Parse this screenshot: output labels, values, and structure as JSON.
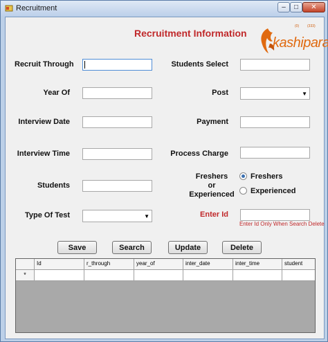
{
  "window": {
    "title": "Recruitment",
    "min_glyph": "–",
    "max_glyph": "□",
    "close_glyph": "✕"
  },
  "header": {
    "title": "Recruitment Information",
    "logo_text": "kashipara",
    "logo_small_left": "(0)",
    "logo_small_right": "(333)"
  },
  "form": {
    "recruit_through": {
      "label": "Recruit Through",
      "value": ""
    },
    "year_of": {
      "label": "Year Of",
      "value": ""
    },
    "interview_date": {
      "label": "Interview Date",
      "value": ""
    },
    "interview_time": {
      "label": "Interview Time",
      "value": ""
    },
    "students": {
      "label": "Students",
      "value": ""
    },
    "type_of_test": {
      "label": "Type Of Test",
      "value": ""
    },
    "students_select": {
      "label": "Students Select",
      "value": ""
    },
    "post": {
      "label": "Post",
      "value": ""
    },
    "payment": {
      "label": "Payment",
      "value": ""
    },
    "process_charge": {
      "label": "Process Charge",
      "value": ""
    },
    "freshers_or_experienced": {
      "label_line1": "Freshers",
      "label_line2": "or",
      "label_line3": "Experienced",
      "options": [
        "Freshers",
        "Experienced"
      ],
      "selected": "Freshers"
    },
    "enter_id": {
      "label": "Enter Id",
      "value": ""
    },
    "hint": "Enter Id Only When Search  Delete"
  },
  "buttons": {
    "save": "Save",
    "search": "Search",
    "update": "Update",
    "delete": "Delete"
  },
  "grid": {
    "columns": [
      "Id",
      "r_through",
      "year_of",
      "inter_date",
      "inter_time",
      "student"
    ],
    "new_row_marker": "*"
  },
  "colors": {
    "heading": "#c0282a",
    "logo": "#e06a10",
    "grid_background": "#a9a9a9"
  }
}
